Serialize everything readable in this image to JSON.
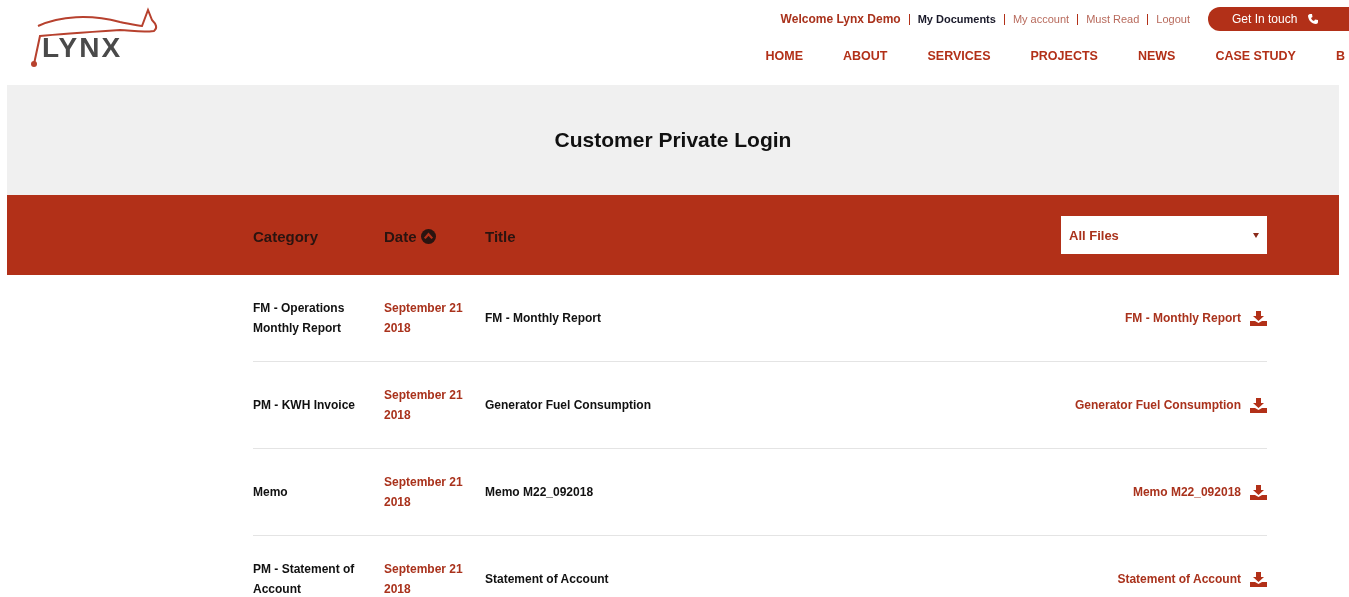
{
  "logo": {
    "text": "LYNX"
  },
  "top_links": {
    "welcome": "Welcome Lynx Demo",
    "links": [
      {
        "label": "My Documents",
        "selected": true
      },
      {
        "label": "My account",
        "selected": false
      },
      {
        "label": "Must Read",
        "selected": false
      },
      {
        "label": "Logout",
        "selected": false
      }
    ],
    "contact_button": "Get In touch"
  },
  "nav": [
    "HOME",
    "ABOUT",
    "SERVICES",
    "PROJECTS",
    "NEWS",
    "CASE STUDY",
    "B"
  ],
  "page_title": "Customer Private Login",
  "table": {
    "columns": [
      {
        "label": "Category",
        "sorted": false
      },
      {
        "label": "Date",
        "sorted": true
      },
      {
        "label": "Title",
        "sorted": false
      }
    ],
    "filter": {
      "value": "All Files"
    },
    "rows": [
      {
        "category": "FM - Operations Monthly Report",
        "date": "September 21 2018",
        "title": "FM - Monthly Report",
        "download": "FM - Monthly Report"
      },
      {
        "category": "PM - KWH Invoice",
        "date": "September 21 2018",
        "title": "Generator Fuel Consumption",
        "download": "Generator Fuel Consumption"
      },
      {
        "category": "Memo",
        "date": "September 21 2018",
        "title": "Memo M22_092018",
        "download": "Memo M22_092018"
      },
      {
        "category": "PM - Statement of Account",
        "date": "September 21 2018",
        "title": "Statement of Account",
        "download": "Statement of Account"
      }
    ]
  }
}
